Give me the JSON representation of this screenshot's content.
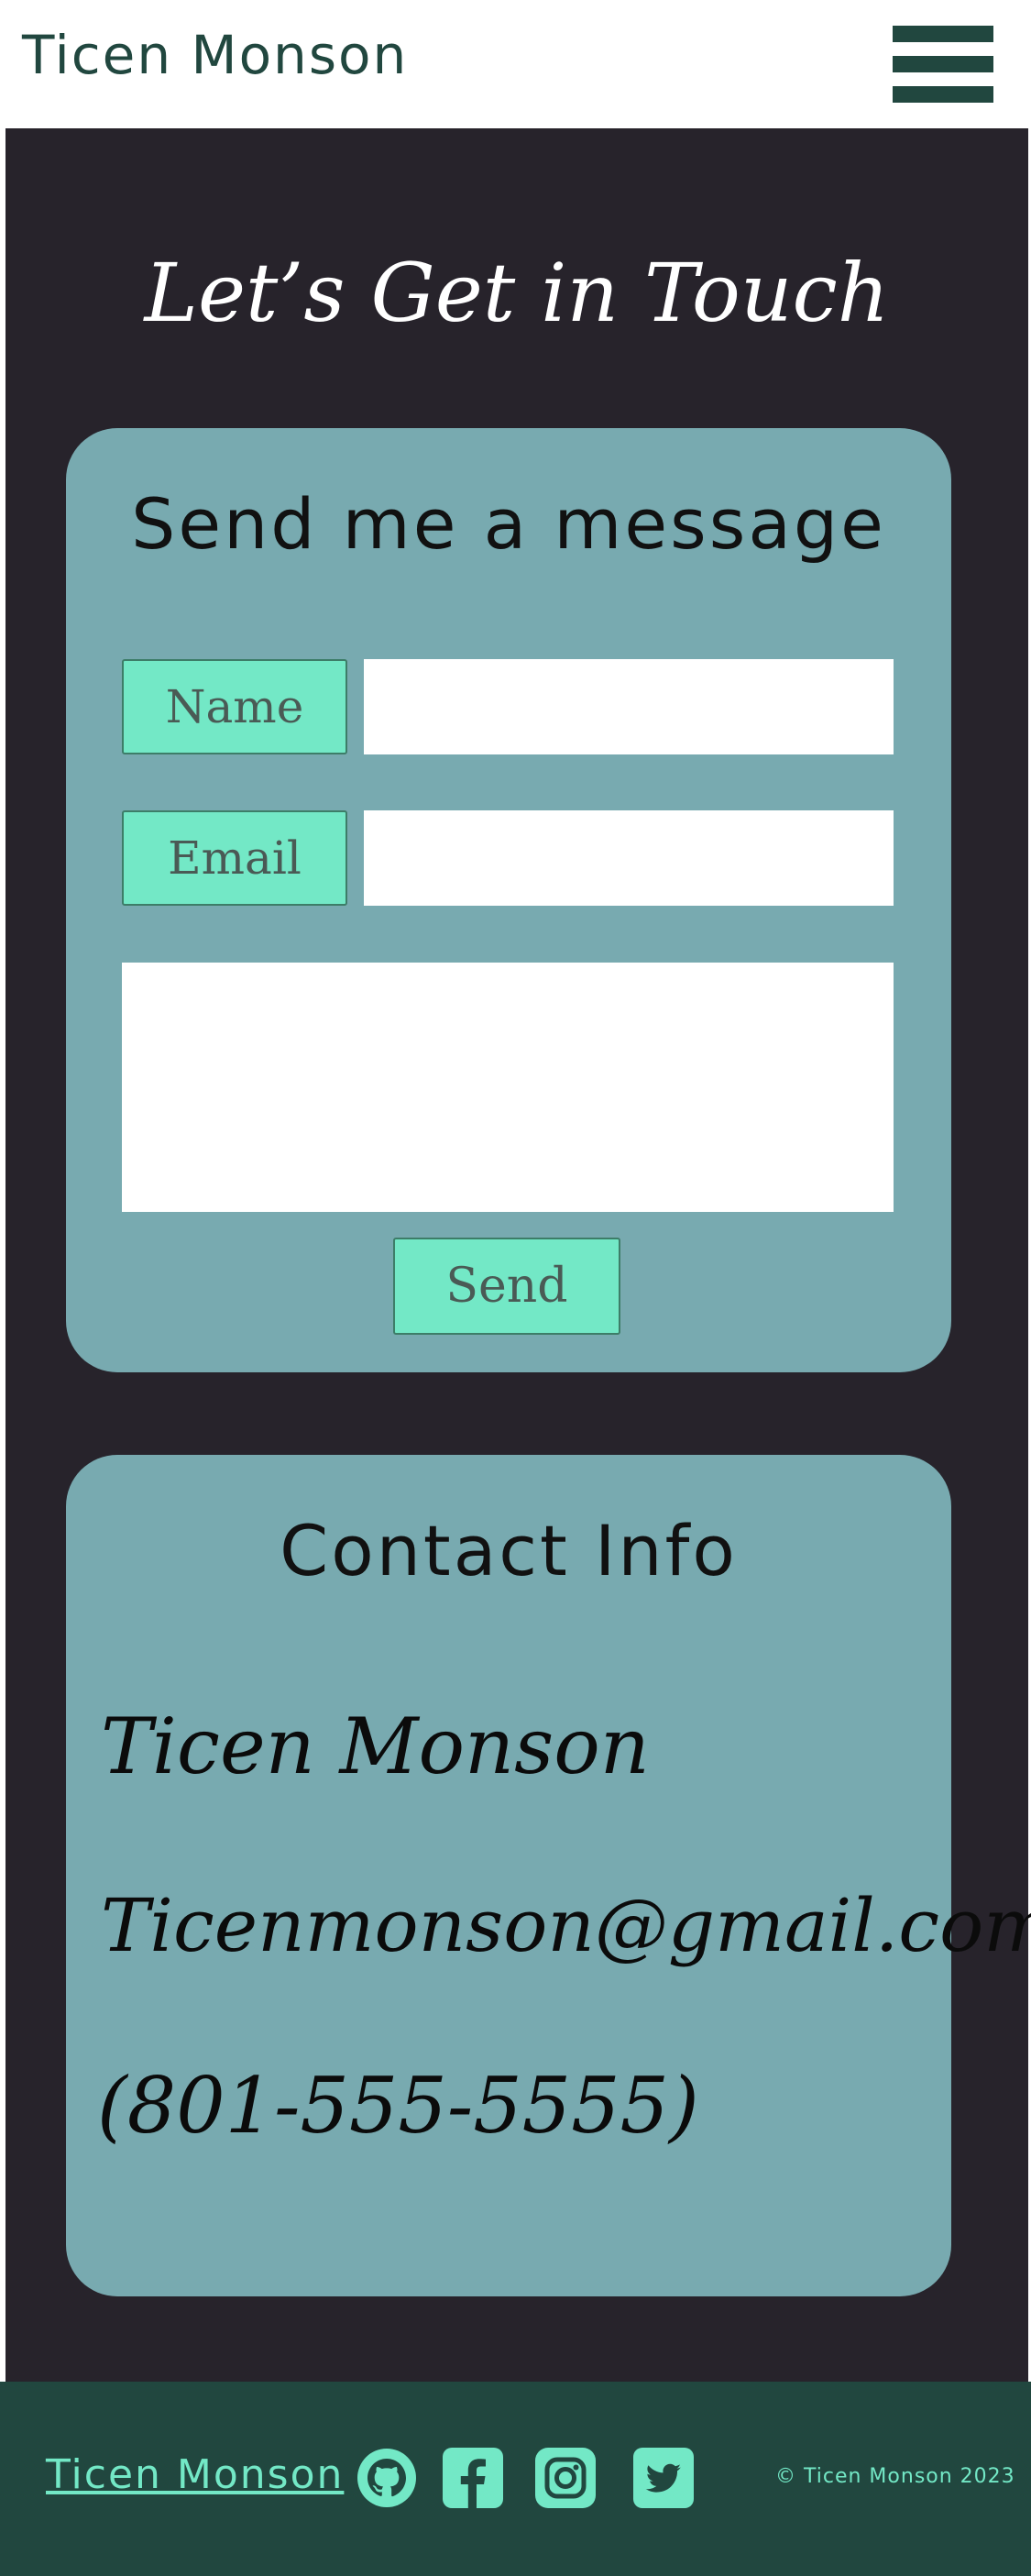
{
  "header": {
    "brand": "Ticen Monson",
    "menu_icon": "hamburger-menu-icon"
  },
  "main": {
    "title": "Let’s Get in Touch",
    "message_card": {
      "title": "Send me a message",
      "name_label": "Name",
      "name_value": "",
      "email_label": "Email",
      "email_value": "",
      "message_value": "",
      "send_label": "Send"
    },
    "info_card": {
      "title": "Contact Info",
      "name": "Ticen Monson",
      "email": "Ticenmonson@gmail.com",
      "phone": "(801-555-5555)"
    }
  },
  "footer": {
    "brand": "Ticen Monson",
    "social": [
      "github-icon",
      "facebook-icon",
      "instagram-icon",
      "twitter-icon"
    ],
    "copyright": "© Ticen Monson 2023"
  },
  "colors": {
    "primary_dark_green": "#21473f",
    "background_dark": "#27232b",
    "card_teal": "#78aab0",
    "accent_mint": "#73e8c6"
  }
}
